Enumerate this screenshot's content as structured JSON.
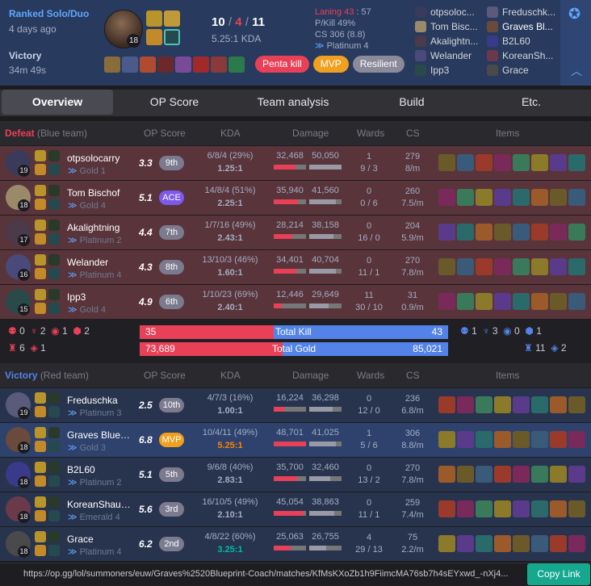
{
  "header": {
    "queue": "Ranked Solo/Duo",
    "ago": "4 days ago",
    "result": "Victory",
    "duration": "34m 49s",
    "champion_level": "18",
    "kills": "10",
    "deaths": "4",
    "assists": "11",
    "kda_ratio": "5.25:1 KDA",
    "laning": "Laning 43",
    "laning_score": "57",
    "pkill": "P/Kill 49%",
    "cs": "CS 306 (8.8)",
    "rank": "Platinum 4",
    "badges": [
      "Penta kill",
      "MVP",
      "Resilient"
    ],
    "left_players": [
      "otpsoloc...",
      "Tom Bisc...",
      "Akalightn...",
      "Welander",
      "Ipp3"
    ],
    "right_players": [
      "Freduschk...",
      "Graves Bl...",
      "B2L60",
      "KoreanSh...",
      "Grace"
    ]
  },
  "tabs": [
    "Overview",
    "OP Score",
    "Team analysis",
    "Build",
    "Etc."
  ],
  "columns": {
    "op": "OP Score",
    "kda": "KDA",
    "damage": "Damage",
    "wards": "Wards",
    "cs": "CS",
    "items": "Items"
  },
  "blue": {
    "result": "Defeat",
    "team": "(Blue team)",
    "players": [
      {
        "name": "otpsolocarry",
        "tier": "Gold 1",
        "level": "19",
        "op": "3.3",
        "rank": "9th",
        "kda": "6/8/4 (29%)",
        "ratio": "1.25:1",
        "dmg": "32,468",
        "taken": "50,050",
        "wards": "1",
        "wards2": "9 / 3",
        "cs": "279",
        "csm": "8/m"
      },
      {
        "name": "Tom Bischof",
        "tier": "Gold 4",
        "level": "18",
        "op": "5.1",
        "rank": "ACE",
        "kda": "14/8/4 (51%)",
        "ratio": "2.25:1",
        "dmg": "35,940",
        "taken": "41,560",
        "wards": "0",
        "wards2": "0 / 6",
        "cs": "260",
        "csm": "7.5/m"
      },
      {
        "name": "Akalightning",
        "tier": "Platinum 2",
        "level": "17",
        "op": "4.4",
        "rank": "7th",
        "kda": "1/7/16 (49%)",
        "ratio": "2.43:1",
        "dmg": "28,214",
        "taken": "38,158",
        "wards": "0",
        "wards2": "16 / 0",
        "cs": "204",
        "csm": "5.9/m"
      },
      {
        "name": "Welander",
        "tier": "Platinum 4",
        "level": "16",
        "op": "4.3",
        "rank": "8th",
        "kda": "13/10/3 (46%)",
        "ratio": "1.60:1",
        "dmg": "34,401",
        "taken": "40,704",
        "wards": "0",
        "wards2": "11 / 1",
        "cs": "270",
        "csm": "7.8/m"
      },
      {
        "name": "Ipp3",
        "tier": "Gold 4",
        "level": "15",
        "op": "4.9",
        "rank": "6th",
        "kda": "1/10/23 (69%)",
        "ratio": "2.40:1",
        "dmg": "12,446",
        "taken": "29,649",
        "wards": "11",
        "wards2": "30 / 10",
        "cs": "31",
        "csm": "0.9/m"
      }
    ]
  },
  "red": {
    "result": "Victory",
    "team": "(Red team)",
    "players": [
      {
        "name": "Freduschka",
        "tier": "Platinum 3",
        "level": "19",
        "op": "2.5",
        "rank": "10th",
        "kda": "4/7/3 (16%)",
        "ratio": "1.00:1",
        "dmg": "16,224",
        "taken": "36,298",
        "wards": "0",
        "wards2": "12 / 0",
        "cs": "236",
        "csm": "6.8/m"
      },
      {
        "name": "Graves Bluep...",
        "tier": "Gold 3",
        "level": "18",
        "op": "6.8",
        "rank": "MVP",
        "kda": "10/4/11 (49%)",
        "ratio": "5.25:1",
        "dmg": "48,701",
        "taken": "41,025",
        "wards": "1",
        "wards2": "5 / 6",
        "cs": "306",
        "csm": "8.8/m"
      },
      {
        "name": "B2L60",
        "tier": "Platinum 2",
        "level": "18",
        "op": "5.1",
        "rank": "5th",
        "kda": "9/6/8 (40%)",
        "ratio": "2.83:1",
        "dmg": "35,700",
        "taken": "32,460",
        "wards": "0",
        "wards2": "13 / 2",
        "cs": "270",
        "csm": "7.8/m"
      },
      {
        "name": "KoreanShaun...",
        "tier": "Emerald 4",
        "level": "18",
        "op": "5.6",
        "rank": "3rd",
        "kda": "16/10/5 (49%)",
        "ratio": "2.10:1",
        "dmg": "45,054",
        "taken": "38,863",
        "wards": "0",
        "wards2": "11 / 1",
        "cs": "259",
        "csm": "7.4/m"
      },
      {
        "name": "Grace",
        "tier": "Platinum 4",
        "level": "18",
        "op": "6.2",
        "rank": "2nd",
        "kda": "4/8/22 (60%)",
        "ratio": "3.25:1",
        "dmg": "25,063",
        "taken": "26,755",
        "wards": "4",
        "wards2": "29 / 13",
        "cs": "75",
        "csm": "2.2/m"
      }
    ]
  },
  "summary": {
    "red_kill": "35",
    "blue_kill": "43",
    "total_kill": "Total Kill",
    "red_gold": "73,689",
    "blue_gold": "85,021",
    "total_gold": "Total Gold",
    "left_obj": [
      "0",
      "2",
      "1",
      "2",
      "6",
      "1"
    ],
    "right_obj": [
      "1",
      "3",
      "0",
      "1",
      "11",
      "2"
    ]
  },
  "url": "https://op.gg/lol/summoners/euw/Graves%2520Blueprint-Coach/matches/KfMsKXoZb1h9FiimcMA76sb7h4sEYxwd_-nXj4...",
  "copy_label": "Copy Link"
}
